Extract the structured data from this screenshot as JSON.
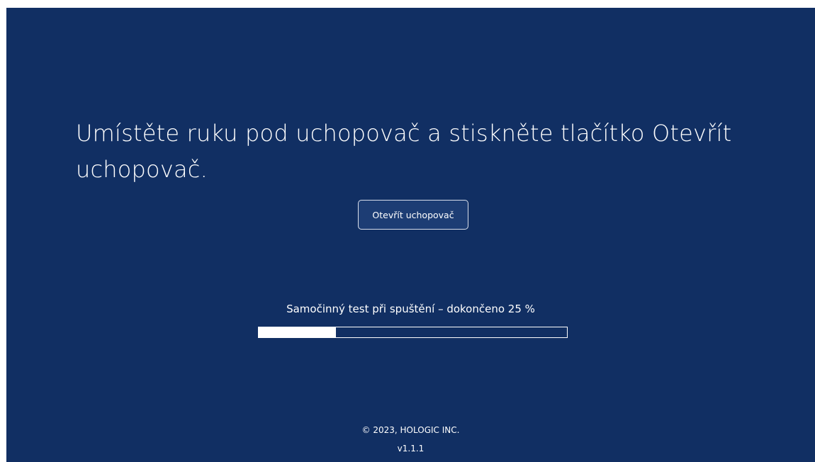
{
  "instruction": {
    "text": "Umístěte ruku pod uchopovač a stiskněte tlačítko Otevřít uchopovač."
  },
  "open_button": {
    "label": "Otevřít uchopovač"
  },
  "self_test": {
    "label": "Samočinný test při spuštění – dokončeno 25 %",
    "progress_percent": 25
  },
  "footer": {
    "copyright": "© 2023, HOLOGIC INC.",
    "version": "v1.1.1"
  },
  "colors": {
    "background": "#112f63",
    "foreground": "#ffffff"
  }
}
